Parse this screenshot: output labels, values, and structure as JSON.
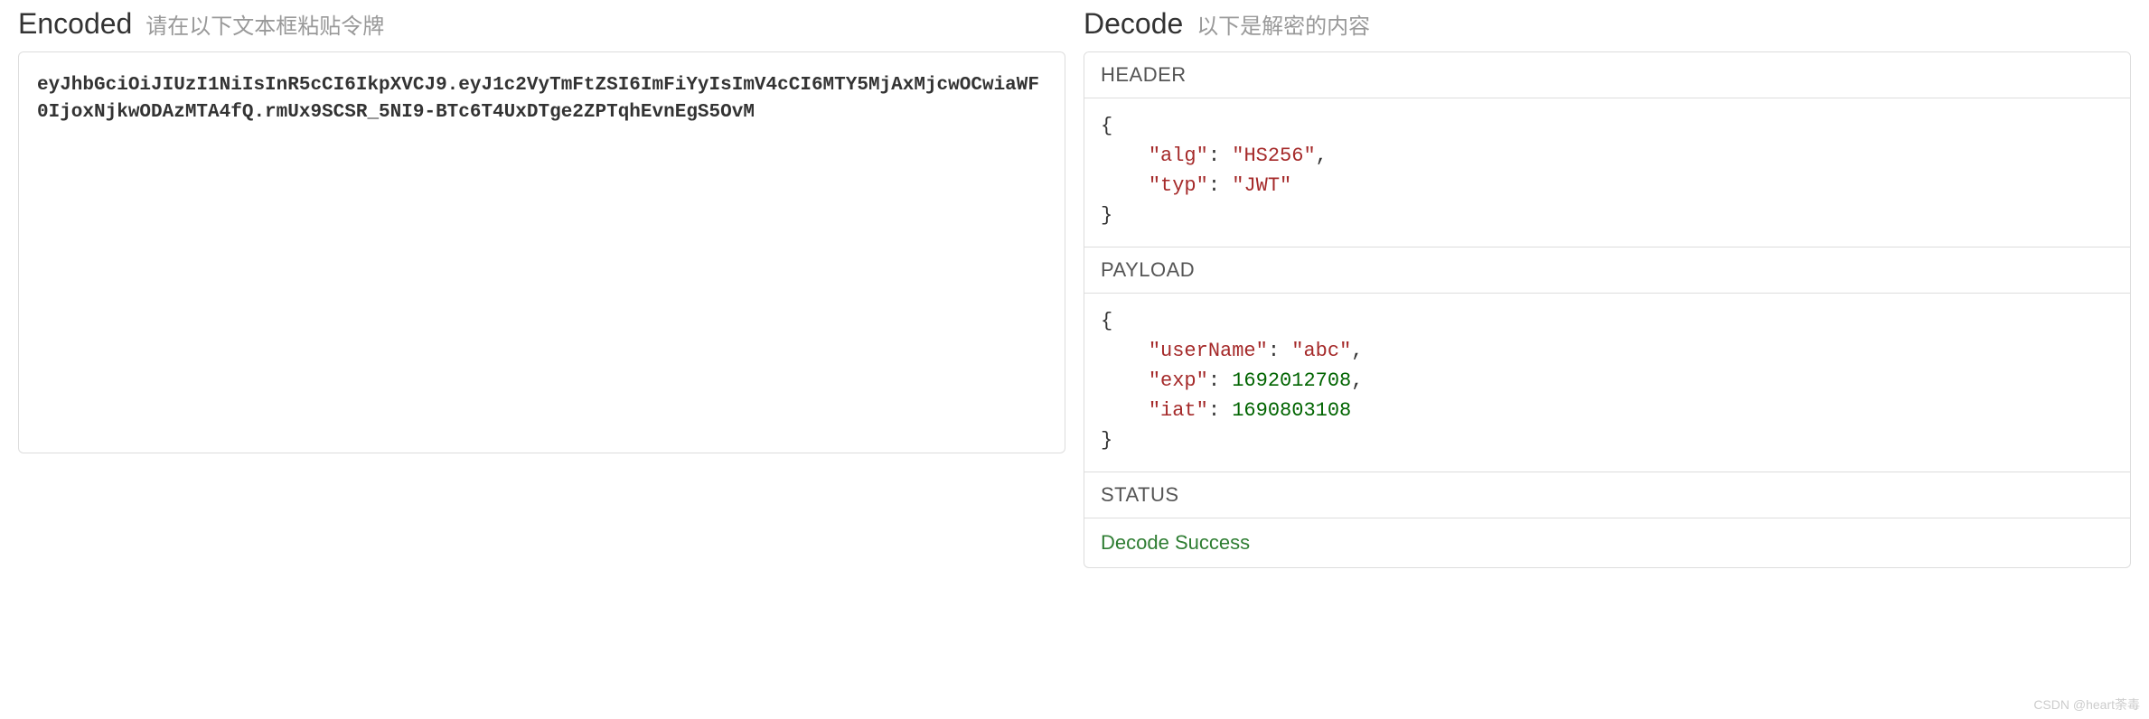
{
  "encoded": {
    "title": "Encoded",
    "subtitle": "请在以下文本框粘贴令牌",
    "token": "eyJhbGciOiJIUzI1NiIsInR5cCI6IkpXVCJ9.eyJ1c2VyTmFtZSI6ImFiYyIsImV4cCI6MTY5MjAxMjcwOCwiaWF0IjoxNjkwODAzMTA4fQ.rmUx9SCSR_5NI9-BTc6T4UxDTge2ZPTqhEvnEgS5OvM"
  },
  "decode": {
    "title": "Decode",
    "subtitle": "以下是解密的内容",
    "sections": {
      "header": {
        "label": "HEADER",
        "data": {
          "alg": "HS256",
          "typ": "JWT"
        }
      },
      "payload": {
        "label": "PAYLOAD",
        "data": {
          "userName": "abc",
          "exp": 1692012708,
          "iat": 1690803108
        }
      },
      "status": {
        "label": "STATUS",
        "message": "Decode Success"
      }
    }
  },
  "watermark": "CSDN @heart荼毒"
}
